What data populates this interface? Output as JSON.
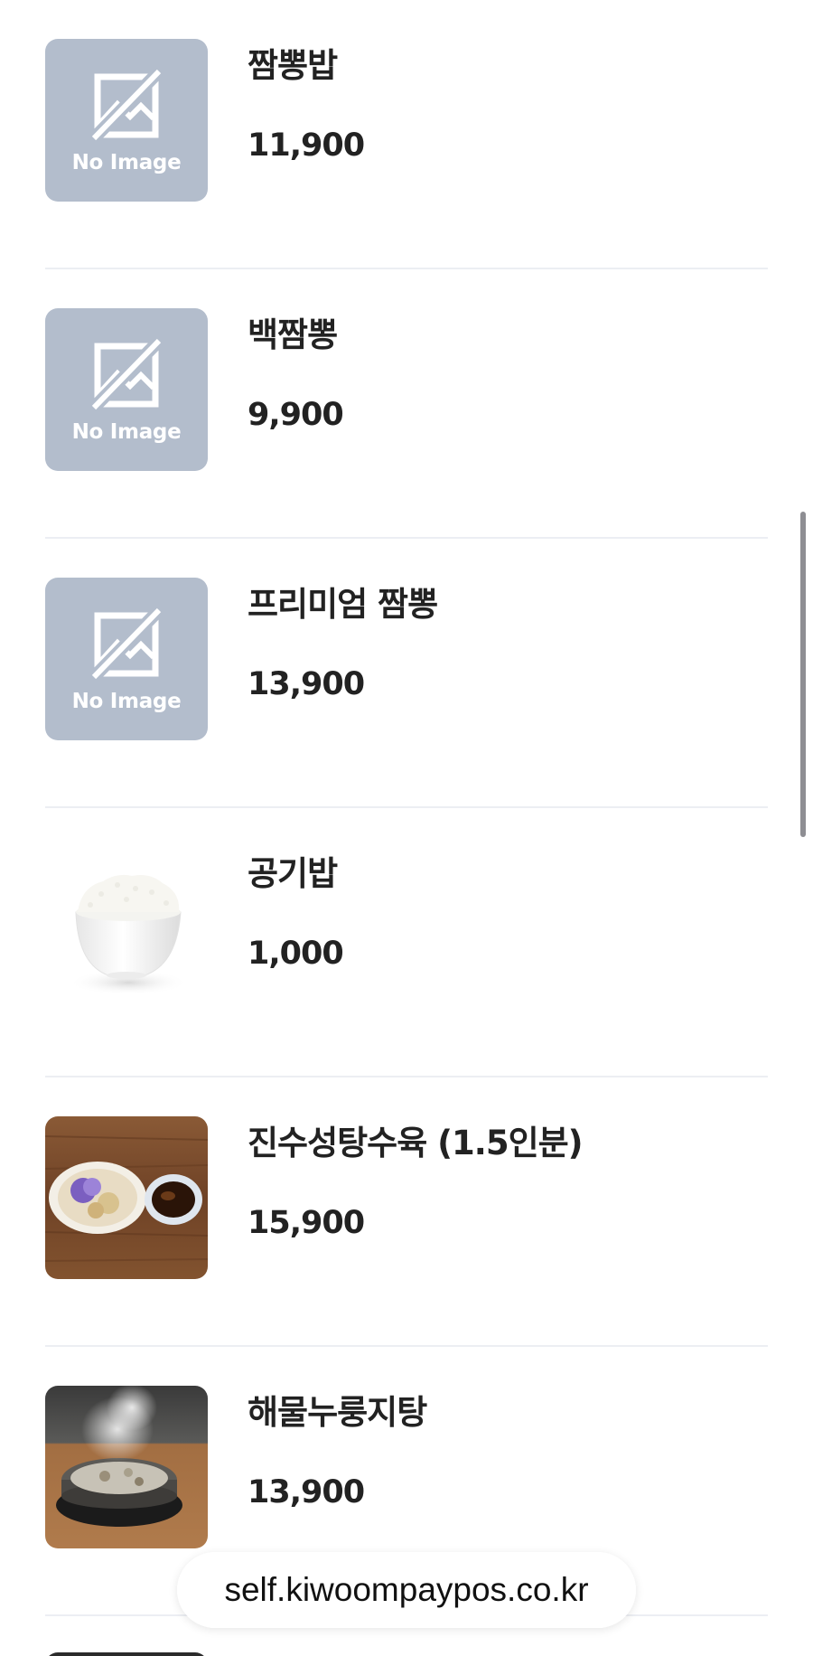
{
  "menu_items": [
    {
      "name": "짬뽕밥",
      "price": "11,900",
      "image": "no-image"
    },
    {
      "name": "백짬뽕",
      "price": "9,900",
      "image": "no-image"
    },
    {
      "name": "프리미엄 짬뽕",
      "price": "13,900",
      "image": "no-image"
    },
    {
      "name": "공기밥",
      "price": "1,000",
      "image": "rice-bowl-photo"
    },
    {
      "name": "진수성탕수육 (1.5인분)",
      "price": "15,900",
      "image": "sweet-sour-pork-photo"
    },
    {
      "name": "해물누룽지탕",
      "price": "13,900",
      "image": "seafood-scorched-rice-soup-photo"
    }
  ],
  "placeholder": {
    "text": "No Image"
  },
  "browser": {
    "url": "self.kiwoompaypos.co.kr"
  },
  "colors": {
    "placeholder_bg": "#b3bdcc",
    "text": "#222222",
    "divider": "#eceef3",
    "wood": "#7a4a2a"
  }
}
